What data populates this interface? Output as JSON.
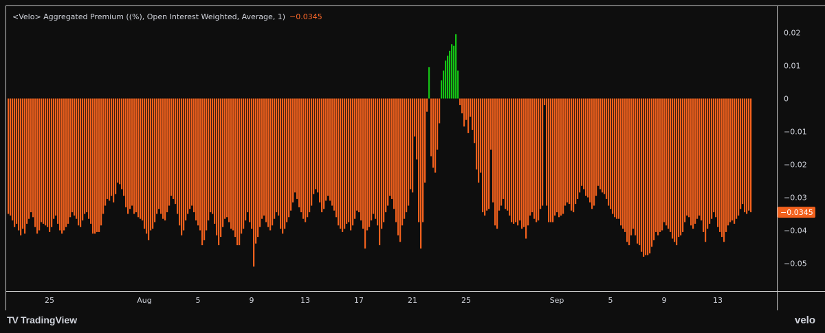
{
  "legend": {
    "title": "<Velo> Aggregated Premium ((%), Open Interest Weighted, Average, 1)",
    "value": "−0.0345"
  },
  "footer": {
    "brand_left": "TradingView",
    "brand_right": "velo"
  },
  "colors": {
    "negative": "#f2611d",
    "positive": "#15c215",
    "background": "#0e0e0e",
    "axis": "#d1d4dc",
    "tag_bg": "#f2611d"
  },
  "chart_data": {
    "type": "bar",
    "title": "<Velo> Aggregated Premium ((%), Open Interest Weighted, Average, 1)",
    "last_value_label": "−0.0345",
    "ylim": [
      -0.057,
      0.023
    ],
    "y_ticks": [
      {
        "v": 0.02,
        "label": "0.02"
      },
      {
        "v": 0.01,
        "label": "0.01"
      },
      {
        "v": 0,
        "label": "0"
      },
      {
        "v": -0.01,
        "label": "−0.01"
      },
      {
        "v": -0.02,
        "label": "−0.02"
      },
      {
        "v": -0.03,
        "label": "−0.03"
      },
      {
        "v": -0.04,
        "label": "−0.04"
      },
      {
        "v": -0.05,
        "label": "−0.05"
      }
    ],
    "x_ticks": [
      {
        "i": 20,
        "label": "25"
      },
      {
        "i": 66,
        "label": "Aug"
      },
      {
        "i": 92,
        "label": "5"
      },
      {
        "i": 118,
        "label": "9"
      },
      {
        "i": 144,
        "label": "13"
      },
      {
        "i": 170,
        "label": "17"
      },
      {
        "i": 196,
        "label": "21"
      },
      {
        "i": 222,
        "label": "25"
      },
      {
        "i": 266,
        "label": "Sep"
      },
      {
        "i": 292,
        "label": "5"
      },
      {
        "i": 318,
        "label": "9"
      },
      {
        "i": 344,
        "label": "13"
      }
    ],
    "values": [
      -0.035,
      -0.0355,
      -0.037,
      -0.039,
      -0.038,
      -0.04,
      -0.0415,
      -0.0395,
      -0.041,
      -0.038,
      -0.0365,
      -0.0345,
      -0.036,
      -0.039,
      -0.041,
      -0.04,
      -0.0375,
      -0.038,
      -0.0385,
      -0.039,
      -0.0405,
      -0.039,
      -0.0365,
      -0.0355,
      -0.038,
      -0.04,
      -0.041,
      -0.04,
      -0.039,
      -0.038,
      -0.036,
      -0.0345,
      -0.0355,
      -0.0365,
      -0.0385,
      -0.039,
      -0.037,
      -0.035,
      -0.0345,
      -0.0365,
      -0.038,
      -0.041,
      -0.041,
      -0.0405,
      -0.0405,
      -0.0385,
      -0.035,
      -0.0325,
      -0.0305,
      -0.031,
      -0.0295,
      -0.0315,
      -0.029,
      -0.0255,
      -0.026,
      -0.0275,
      -0.0295,
      -0.033,
      -0.035,
      -0.0335,
      -0.0325,
      -0.035,
      -0.0345,
      -0.036,
      -0.0365,
      -0.037,
      -0.0395,
      -0.041,
      -0.043,
      -0.04,
      -0.0395,
      -0.0375,
      -0.035,
      -0.0335,
      -0.035,
      -0.0365,
      -0.037,
      -0.0345,
      -0.0325,
      -0.0295,
      -0.0305,
      -0.032,
      -0.035,
      -0.0385,
      -0.0415,
      -0.04,
      -0.037,
      -0.035,
      -0.0335,
      -0.0325,
      -0.0345,
      -0.037,
      -0.0385,
      -0.04,
      -0.0445,
      -0.043,
      -0.04,
      -0.037,
      -0.0345,
      -0.035,
      -0.038,
      -0.0415,
      -0.0445,
      -0.042,
      -0.039,
      -0.0365,
      -0.036,
      -0.0375,
      -0.0395,
      -0.04,
      -0.042,
      -0.0445,
      -0.0445,
      -0.041,
      -0.0395,
      -0.037,
      -0.0345,
      -0.0375,
      -0.0395,
      -0.051,
      -0.044,
      -0.042,
      -0.039,
      -0.0365,
      -0.0355,
      -0.0375,
      -0.039,
      -0.04,
      -0.0385,
      -0.0365,
      -0.0345,
      -0.0355,
      -0.0395,
      -0.041,
      -0.0395,
      -0.0375,
      -0.036,
      -0.034,
      -0.0315,
      -0.0285,
      -0.0305,
      -0.033,
      -0.0345,
      -0.0365,
      -0.0375,
      -0.036,
      -0.0345,
      -0.0325,
      -0.029,
      -0.0275,
      -0.0285,
      -0.0315,
      -0.0345,
      -0.0335,
      -0.031,
      -0.0295,
      -0.031,
      -0.0325,
      -0.034,
      -0.036,
      -0.0385,
      -0.0395,
      -0.0405,
      -0.0395,
      -0.038,
      -0.0375,
      -0.04,
      -0.0385,
      -0.0365,
      -0.034,
      -0.0345,
      -0.037,
      -0.0395,
      -0.0455,
      -0.04,
      -0.039,
      -0.037,
      -0.035,
      -0.0365,
      -0.0385,
      -0.0445,
      -0.0395,
      -0.0375,
      -0.0345,
      -0.0325,
      -0.0295,
      -0.0305,
      -0.0335,
      -0.0375,
      -0.0415,
      -0.0435,
      -0.0385,
      -0.0365,
      -0.0345,
      -0.0325,
      -0.0275,
      -0.0285,
      -0.0115,
      -0.0185,
      -0.0375,
      -0.0455,
      -0.0375,
      -0.0255,
      -0.004,
      0.0095,
      -0.0175,
      -0.021,
      -0.0225,
      -0.0155,
      -0.0075,
      0.0055,
      0.0085,
      0.0115,
      0.013,
      0.0145,
      0.0165,
      0.016,
      0.0195,
      0.0085,
      -0.002,
      -0.0045,
      -0.0085,
      -0.0065,
      -0.0105,
      -0.0055,
      -0.0095,
      -0.0135,
      -0.0215,
      -0.0255,
      -0.0225,
      -0.0345,
      -0.0355,
      -0.034,
      -0.0335,
      -0.0155,
      -0.0315,
      -0.0385,
      -0.0395,
      -0.034,
      -0.0325,
      -0.0305,
      -0.0335,
      -0.034,
      -0.0355,
      -0.0375,
      -0.038,
      -0.0375,
      -0.0385,
      -0.037,
      -0.0395,
      -0.039,
      -0.0425,
      -0.0385,
      -0.0355,
      -0.0345,
      -0.0365,
      -0.0375,
      -0.037,
      -0.0335,
      -0.0325,
      -0.002,
      -0.0325,
      -0.0375,
      -0.0375,
      -0.0375,
      -0.0355,
      -0.0345,
      -0.036,
      -0.0355,
      -0.035,
      -0.0325,
      -0.0315,
      -0.032,
      -0.034,
      -0.0345,
      -0.032,
      -0.0305,
      -0.0285,
      -0.0265,
      -0.0275,
      -0.0295,
      -0.03,
      -0.0315,
      -0.0335,
      -0.0325,
      -0.0295,
      -0.0265,
      -0.0275,
      -0.0285,
      -0.029,
      -0.0305,
      -0.0325,
      -0.0335,
      -0.035,
      -0.036,
      -0.0365,
      -0.0365,
      -0.0385,
      -0.0395,
      -0.0405,
      -0.0435,
      -0.0445,
      -0.0415,
      -0.0395,
      -0.0415,
      -0.044,
      -0.0445,
      -0.0465,
      -0.048,
      -0.0475,
      -0.0475,
      -0.047,
      -0.045,
      -0.043,
      -0.0405,
      -0.0415,
      -0.0405,
      -0.04,
      -0.0375,
      -0.0385,
      -0.0395,
      -0.0405,
      -0.0425,
      -0.0435,
      -0.0445,
      -0.042,
      -0.0415,
      -0.0405,
      -0.0375,
      -0.0355,
      -0.036,
      -0.0385,
      -0.0395,
      -0.038,
      -0.0365,
      -0.0355,
      -0.037,
      -0.0405,
      -0.0435,
      -0.0395,
      -0.038,
      -0.0365,
      -0.0345,
      -0.036,
      -0.039,
      -0.0405,
      -0.042,
      -0.0435,
      -0.0405,
      -0.0385,
      -0.0375,
      -0.037,
      -0.038,
      -0.0365,
      -0.0355,
      -0.0335,
      -0.032,
      -0.0345,
      -0.035,
      -0.034,
      -0.0345
    ]
  }
}
